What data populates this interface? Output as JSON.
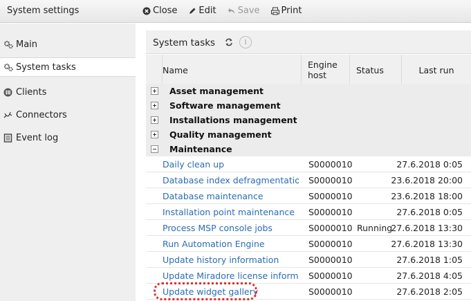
{
  "app": {
    "title": "System settings"
  },
  "toolbar": {
    "close_label": "Close",
    "edit_label": "Edit",
    "save_label": "Save",
    "print_label": "Print"
  },
  "sidebar": {
    "items": [
      {
        "label": "Main",
        "icon": "gears-icon"
      },
      {
        "label": "System tasks",
        "icon": "gears-icon",
        "active": true
      },
      {
        "label": "Clients",
        "icon": "clients-icon"
      },
      {
        "label": "Connectors",
        "icon": "connectors-icon"
      },
      {
        "label": "Event log",
        "icon": "event-log-icon"
      }
    ]
  },
  "main": {
    "title": "System tasks",
    "info_glyph": "i",
    "columns": {
      "name": "Name",
      "engine_host_1": "Engine",
      "engine_host_2": "host",
      "status": "Status",
      "last_run": "Last run"
    },
    "groups": [
      {
        "label": "Asset management",
        "expanded": false
      },
      {
        "label": "Software management",
        "expanded": false
      },
      {
        "label": "Installations management",
        "expanded": false
      },
      {
        "label": "Quality management",
        "expanded": false
      },
      {
        "label": "Maintenance",
        "expanded": true
      }
    ],
    "tasks": [
      {
        "name": "Daily clean up",
        "host": "S0000010",
        "status": "",
        "last_run": "27.6.2018 0:05"
      },
      {
        "name": "Database index defragmentation",
        "host": "S0000010",
        "status": "",
        "last_run": "23.6.2018 20:00"
      },
      {
        "name": "Database maintenance",
        "host": "S0000010",
        "status": "",
        "last_run": "23.6.2018 18:00"
      },
      {
        "name": "Installation point maintenance",
        "host": "S0000010",
        "status": "",
        "last_run": "27.6.2018 0:05"
      },
      {
        "name": "Process MSP console jobs",
        "host": "S0000010",
        "status": "Running",
        "last_run": "27.6.2018 13:30"
      },
      {
        "name": "Run Automation Engine",
        "host": "S0000010",
        "status": "",
        "last_run": "27.6.2018 13:30"
      },
      {
        "name": "Update history information",
        "host": "S0000010",
        "status": "",
        "last_run": "27.6.2018 1:05"
      },
      {
        "name": "Update Miradore license informa...",
        "host": "S0000010",
        "status": "",
        "last_run": "27.6.2018 4:05"
      },
      {
        "name": "Update widget gallery",
        "host": "S0000010",
        "status": "",
        "last_run": "27.6.2018 2:05"
      }
    ]
  },
  "colors": {
    "link": "#2b6cb3",
    "highlight": "#e0302a",
    "sidebar_bg": "#efefef"
  }
}
